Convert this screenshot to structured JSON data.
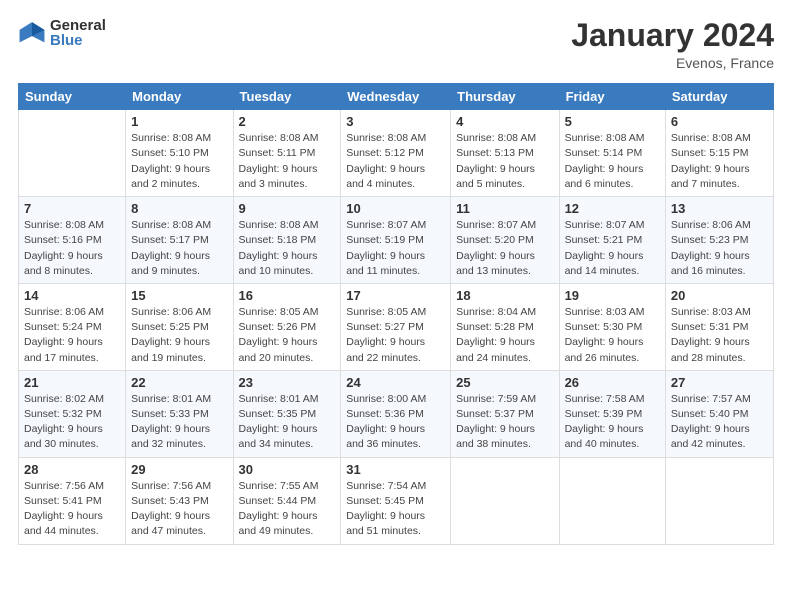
{
  "header": {
    "logo": {
      "general": "General",
      "blue": "Blue"
    },
    "title": "January 2024",
    "location": "Evenos, France"
  },
  "days_of_week": [
    "Sunday",
    "Monday",
    "Tuesday",
    "Wednesday",
    "Thursday",
    "Friday",
    "Saturday"
  ],
  "weeks": [
    [
      {
        "day": "",
        "info": ""
      },
      {
        "day": "1",
        "info": "Sunrise: 8:08 AM\nSunset: 5:10 PM\nDaylight: 9 hours\nand 2 minutes."
      },
      {
        "day": "2",
        "info": "Sunrise: 8:08 AM\nSunset: 5:11 PM\nDaylight: 9 hours\nand 3 minutes."
      },
      {
        "day": "3",
        "info": "Sunrise: 8:08 AM\nSunset: 5:12 PM\nDaylight: 9 hours\nand 4 minutes."
      },
      {
        "day": "4",
        "info": "Sunrise: 8:08 AM\nSunset: 5:13 PM\nDaylight: 9 hours\nand 5 minutes."
      },
      {
        "day": "5",
        "info": "Sunrise: 8:08 AM\nSunset: 5:14 PM\nDaylight: 9 hours\nand 6 minutes."
      },
      {
        "day": "6",
        "info": "Sunrise: 8:08 AM\nSunset: 5:15 PM\nDaylight: 9 hours\nand 7 minutes."
      }
    ],
    [
      {
        "day": "7",
        "info": "Sunrise: 8:08 AM\nSunset: 5:16 PM\nDaylight: 9 hours\nand 8 minutes."
      },
      {
        "day": "8",
        "info": "Sunrise: 8:08 AM\nSunset: 5:17 PM\nDaylight: 9 hours\nand 9 minutes."
      },
      {
        "day": "9",
        "info": "Sunrise: 8:08 AM\nSunset: 5:18 PM\nDaylight: 9 hours\nand 10 minutes."
      },
      {
        "day": "10",
        "info": "Sunrise: 8:07 AM\nSunset: 5:19 PM\nDaylight: 9 hours\nand 11 minutes."
      },
      {
        "day": "11",
        "info": "Sunrise: 8:07 AM\nSunset: 5:20 PM\nDaylight: 9 hours\nand 13 minutes."
      },
      {
        "day": "12",
        "info": "Sunrise: 8:07 AM\nSunset: 5:21 PM\nDaylight: 9 hours\nand 14 minutes."
      },
      {
        "day": "13",
        "info": "Sunrise: 8:06 AM\nSunset: 5:23 PM\nDaylight: 9 hours\nand 16 minutes."
      }
    ],
    [
      {
        "day": "14",
        "info": "Sunrise: 8:06 AM\nSunset: 5:24 PM\nDaylight: 9 hours\nand 17 minutes."
      },
      {
        "day": "15",
        "info": "Sunrise: 8:06 AM\nSunset: 5:25 PM\nDaylight: 9 hours\nand 19 minutes."
      },
      {
        "day": "16",
        "info": "Sunrise: 8:05 AM\nSunset: 5:26 PM\nDaylight: 9 hours\nand 20 minutes."
      },
      {
        "day": "17",
        "info": "Sunrise: 8:05 AM\nSunset: 5:27 PM\nDaylight: 9 hours\nand 22 minutes."
      },
      {
        "day": "18",
        "info": "Sunrise: 8:04 AM\nSunset: 5:28 PM\nDaylight: 9 hours\nand 24 minutes."
      },
      {
        "day": "19",
        "info": "Sunrise: 8:03 AM\nSunset: 5:30 PM\nDaylight: 9 hours\nand 26 minutes."
      },
      {
        "day": "20",
        "info": "Sunrise: 8:03 AM\nSunset: 5:31 PM\nDaylight: 9 hours\nand 28 minutes."
      }
    ],
    [
      {
        "day": "21",
        "info": "Sunrise: 8:02 AM\nSunset: 5:32 PM\nDaylight: 9 hours\nand 30 minutes."
      },
      {
        "day": "22",
        "info": "Sunrise: 8:01 AM\nSunset: 5:33 PM\nDaylight: 9 hours\nand 32 minutes."
      },
      {
        "day": "23",
        "info": "Sunrise: 8:01 AM\nSunset: 5:35 PM\nDaylight: 9 hours\nand 34 minutes."
      },
      {
        "day": "24",
        "info": "Sunrise: 8:00 AM\nSunset: 5:36 PM\nDaylight: 9 hours\nand 36 minutes."
      },
      {
        "day": "25",
        "info": "Sunrise: 7:59 AM\nSunset: 5:37 PM\nDaylight: 9 hours\nand 38 minutes."
      },
      {
        "day": "26",
        "info": "Sunrise: 7:58 AM\nSunset: 5:39 PM\nDaylight: 9 hours\nand 40 minutes."
      },
      {
        "day": "27",
        "info": "Sunrise: 7:57 AM\nSunset: 5:40 PM\nDaylight: 9 hours\nand 42 minutes."
      }
    ],
    [
      {
        "day": "28",
        "info": "Sunrise: 7:56 AM\nSunset: 5:41 PM\nDaylight: 9 hours\nand 44 minutes."
      },
      {
        "day": "29",
        "info": "Sunrise: 7:56 AM\nSunset: 5:43 PM\nDaylight: 9 hours\nand 47 minutes."
      },
      {
        "day": "30",
        "info": "Sunrise: 7:55 AM\nSunset: 5:44 PM\nDaylight: 9 hours\nand 49 minutes."
      },
      {
        "day": "31",
        "info": "Sunrise: 7:54 AM\nSunset: 5:45 PM\nDaylight: 9 hours\nand 51 minutes."
      },
      {
        "day": "",
        "info": ""
      },
      {
        "day": "",
        "info": ""
      },
      {
        "day": "",
        "info": ""
      }
    ]
  ]
}
